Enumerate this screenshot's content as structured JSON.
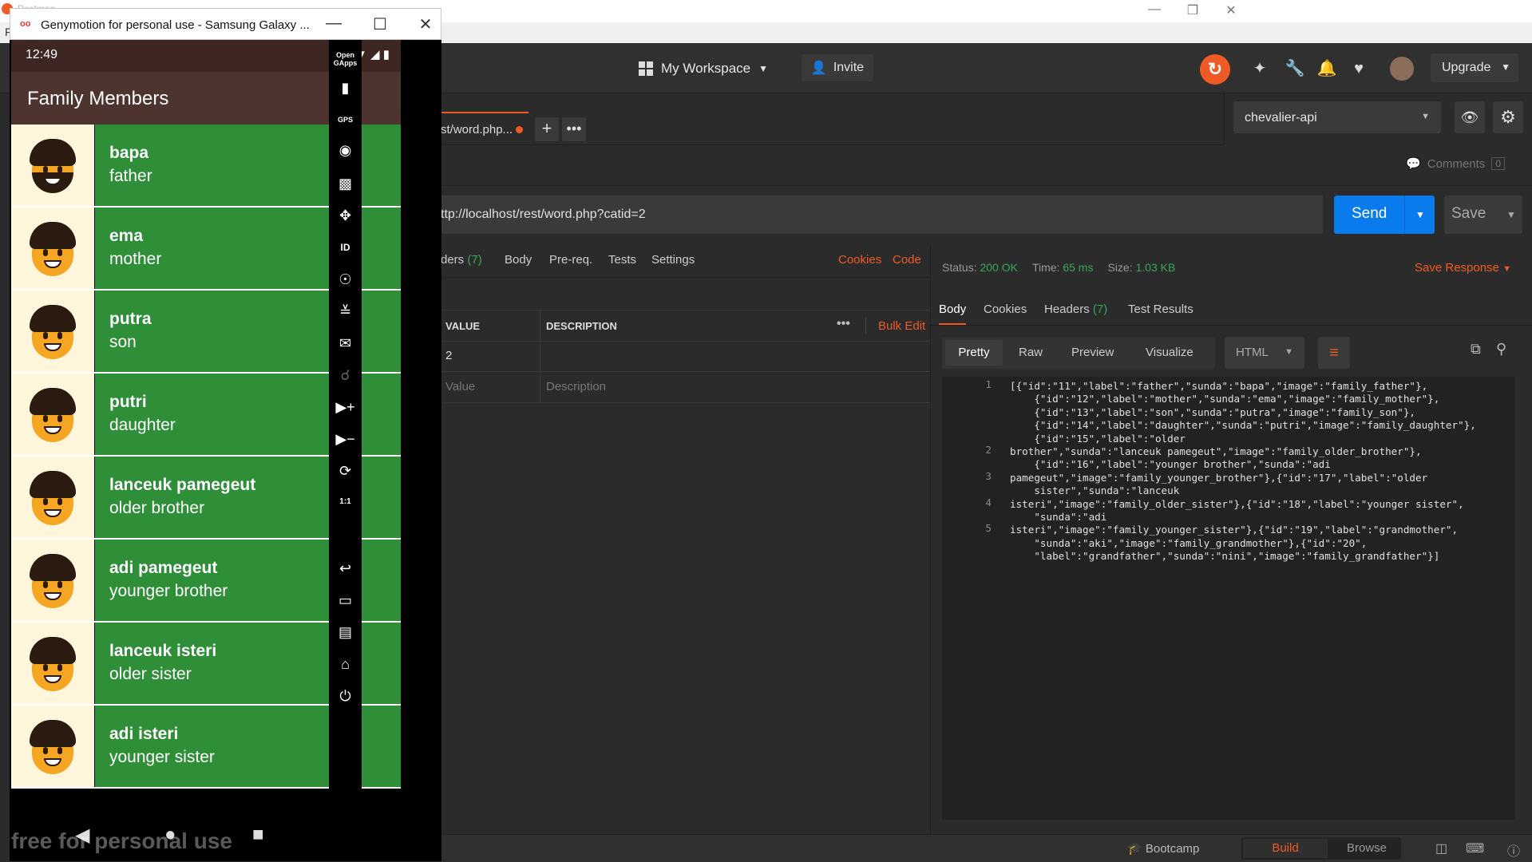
{
  "postman": {
    "title": "Postman",
    "menu_f": "F",
    "workspace": "My Workspace",
    "invite": "Invite",
    "upgrade": "Upgrade",
    "tab": {
      "label": "st/word.php..."
    },
    "environment": "chevalier-api",
    "comments": {
      "label": "Comments",
      "count": "0"
    },
    "url": "ttp://localhost/rest/word.php?catid=2",
    "send": "Send",
    "save": "Save",
    "request_tabs": {
      "headers_label": "ders",
      "headers_count": "(7)",
      "body": "Body",
      "prereq": "Pre-req.",
      "tests": "Tests",
      "settings": "Settings",
      "cookies": "Cookies",
      "code": "Code"
    },
    "params": {
      "col_value": "VALUE",
      "col_description": "DESCRIPTION",
      "bulk_edit": "Bulk Edit",
      "row_value": "2",
      "value_placeholder": "Value",
      "description_placeholder": "Description"
    },
    "response": {
      "status_label": "Status:",
      "status": "200 OK",
      "time_label": "Time:",
      "time": "65 ms",
      "size_label": "Size:",
      "size": "1.03 KB",
      "save_response": "Save Response",
      "tabs": {
        "body": "Body",
        "cookies": "Cookies",
        "headers": "Headers",
        "headers_count": "(7)",
        "tests": "Test Results"
      },
      "formats": {
        "pretty": "Pretty",
        "raw": "Raw",
        "preview": "Preview",
        "visualize": "Visualize"
      },
      "language": "HTML",
      "lines": [
        {
          "n": "1",
          "text": "[{\"id\":\"11\",\"label\":\"father\",\"sunda\":\"bapa\",\"image\":\"family_father\"},"
        },
        {
          "n": "",
          "text": "    {\"id\":\"12\",\"label\":\"mother\",\"sunda\":\"ema\",\"image\":\"family_mother\"},"
        },
        {
          "n": "",
          "text": "    {\"id\":\"13\",\"label\":\"son\",\"sunda\":\"putra\",\"image\":\"family_son\"},"
        },
        {
          "n": "",
          "text": "    {\"id\":\"14\",\"label\":\"daughter\",\"sunda\":\"putri\",\"image\":\"family_daughter\"},"
        },
        {
          "n": "",
          "text": "    {\"id\":\"15\",\"label\":\"older"
        },
        {
          "n": "2",
          "text": "brother\",\"sunda\":\"lanceuk pamegeut\",\"image\":\"family_older_brother\"},"
        },
        {
          "n": "",
          "text": "    {\"id\":\"16\",\"label\":\"younger brother\",\"sunda\":\"adi"
        },
        {
          "n": "3",
          "text": "pamegeut\",\"image\":\"family_younger_brother\"},{\"id\":\"17\",\"label\":\"older"
        },
        {
          "n": "",
          "text": "    sister\",\"sunda\":\"lanceuk"
        },
        {
          "n": "4",
          "text": "isteri\",\"image\":\"family_older_sister\"},{\"id\":\"18\",\"label\":\"younger sister\","
        },
        {
          "n": "",
          "text": "    \"sunda\":\"adi"
        },
        {
          "n": "5",
          "text": "isteri\",\"image\":\"family_younger_sister\"},{\"id\":\"19\",\"label\":\"grandmother\","
        },
        {
          "n": "",
          "text": "    \"sunda\":\"aki\",\"image\":\"family_grandmother\"},{\"id\":\"20\","
        },
        {
          "n": "",
          "text": "    \"label\":\"grandfather\",\"sunda\":\"nini\",\"image\":\"family_grandfather\"}]"
        }
      ]
    },
    "footer": {
      "bootcamp": "Bootcamp",
      "build": "Build",
      "browse": "Browse"
    }
  },
  "genymotion": {
    "window_title": "Genymotion for personal use - Samsung Galaxy ...",
    "watermark": "free for personal use",
    "side_open_gapps": "Open GApps",
    "side_gps": "GPS",
    "side_id": "ID",
    "side_ratio": "1:1",
    "phone": {
      "time": "12:49",
      "app_title": "Family Members",
      "members": [
        {
          "sunda": "bapa",
          "label": "father"
        },
        {
          "sunda": "ema",
          "label": "mother"
        },
        {
          "sunda": "putra",
          "label": "son"
        },
        {
          "sunda": "putri",
          "label": "daughter"
        },
        {
          "sunda": "lanceuk pamegeut",
          "label": "older brother"
        },
        {
          "sunda": "adi pamegeut",
          "label": "younger brother"
        },
        {
          "sunda": "lanceuk isteri",
          "label": "older sister"
        },
        {
          "sunda": "adi isteri",
          "label": "younger sister"
        }
      ]
    }
  }
}
